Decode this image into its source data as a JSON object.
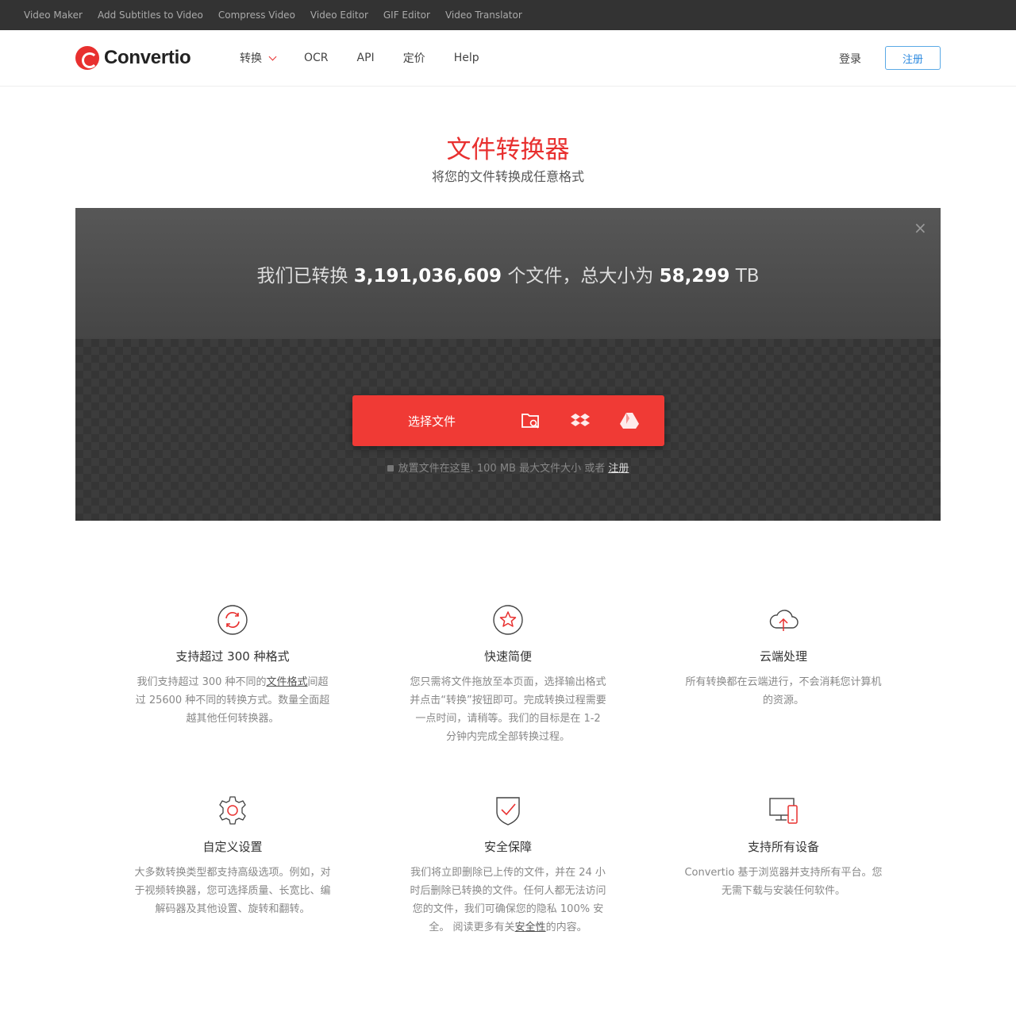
{
  "topbar": {
    "links": [
      "Video Maker",
      "Add Subtitles to Video",
      "Compress Video",
      "Video Editor",
      "GIF Editor",
      "Video Translator"
    ]
  },
  "header": {
    "logo_text": "Convertio",
    "nav": [
      "转换",
      "OCR",
      "API",
      "定价",
      "Help"
    ],
    "login_label": "登录",
    "signup_label": "注册"
  },
  "hero": {
    "title": "文件转换器",
    "subtitle": "将您的文件转换成任意格式"
  },
  "upload": {
    "stats_prefix": "我们已转换 ",
    "files_count": "3,191,036,609",
    "stats_middle": " 个文件，总大小为 ",
    "total_size": "58,299",
    "stats_unit": " TB",
    "choose_label": "选择文件",
    "drop_note": "放置文件在这里. 100 MB 最大文件大小 或者 ",
    "drop_link": "注册",
    "icons": [
      "folder-search-icon",
      "dropbox-icon",
      "google-drive-icon"
    ]
  },
  "features": [
    {
      "icon": "refresh-icon",
      "title": "支持超过 300 种格式",
      "desc_pre": "我们支持超过 300 种不同的",
      "desc_link": "文件格式",
      "desc_post": "间超过 25600 种不同的转换方式。数量全面超越其他任何转换器。"
    },
    {
      "icon": "star-icon",
      "title": "快速简便",
      "desc_pre": "您只需将文件拖放至本页面，选择输出格式并点击“转换”按钮即可。完成转换过程需要一点时间，请稍等。我们的目标是在 1-2 分钟内完成全部转换过程。",
      "desc_link": "",
      "desc_post": ""
    },
    {
      "icon": "cloud-upload-icon",
      "title": "云端处理",
      "desc_pre": "所有转换都在云端进行，不会消耗您计算机的资源。",
      "desc_link": "",
      "desc_post": ""
    },
    {
      "icon": "gear-icon",
      "title": "自定义设置",
      "desc_pre": "大多数转换类型都支持高级选项。例如，对于视频转换器，您可选择质量、长宽比、编解码器及其他设置、旋转和翻转。",
      "desc_link": "",
      "desc_post": ""
    },
    {
      "icon": "shield-check-icon",
      "title": "安全保障",
      "desc_pre": "我们将立即删除已上传的文件，并在 24 小时后删除已转换的文件。任何人都无法访问您的文件，我们可确保您的隐私 100% 安全。 阅读更多有关",
      "desc_link": "安全性",
      "desc_post": "的内容。"
    },
    {
      "icon": "devices-icon",
      "title": "支持所有设备",
      "desc_pre": "Convertio 基于浏览器并支持所有平台。您无需下载与安装任何软件。",
      "desc_link": "",
      "desc_post": ""
    }
  ],
  "colors": {
    "brand": "#e8302f",
    "button": "#f03a35",
    "signup_border": "#5aa9e6"
  }
}
